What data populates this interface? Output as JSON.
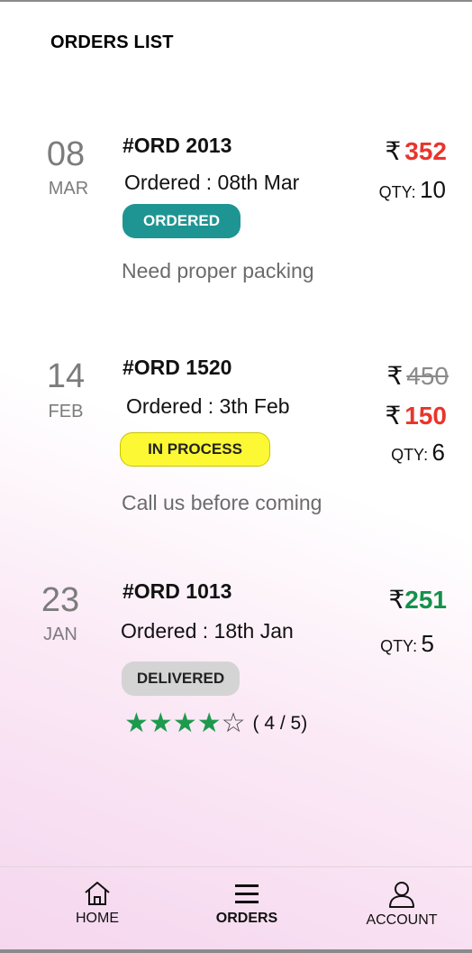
{
  "header": {
    "title": "ORDERS LIST"
  },
  "currency_symbol": "₹",
  "orders": [
    {
      "day": "08",
      "month": "MAR",
      "id": "#ORD 2013",
      "ordered_text": "Ordered : 08th Mar",
      "status": "ORDERED",
      "note": "Need proper packing",
      "price": "352",
      "qty_label": "QTY:",
      "qty": "10"
    },
    {
      "day": "14",
      "month": "FEB",
      "id": "#ORD 1520",
      "ordered_text": "Ordered : 3th Feb",
      "status": "IN PROCESS",
      "note": "Call us before coming",
      "original_price": "450",
      "price": "150",
      "qty_label": "QTY:",
      "qty": "6"
    },
    {
      "day": "23",
      "month": "JAN",
      "id": "#ORD 1013",
      "ordered_text": "Ordered : 18th Jan",
      "status": "DELIVERED",
      "price": "251",
      "qty_label": "QTY:",
      "qty": "5",
      "rating": {
        "value": 4,
        "max": 5,
        "text": "( 4 / 5)"
      }
    }
  ],
  "nav": {
    "home": "HOME",
    "orders": "ORDERS",
    "account": "ACCOUNT"
  },
  "colors": {
    "ordered_badge": "#1e9593",
    "in_process_badge": "#fcf833",
    "delivered_badge": "#d4d4d4",
    "price_red": "#e8352b",
    "price_green": "#14924a",
    "star_green": "#1d9a4d"
  },
  "icons": {
    "home": "home-icon",
    "orders": "menu-lines-icon",
    "account": "user-icon",
    "star_filled": "star-filled-icon",
    "star_empty": "star-outline-icon"
  }
}
